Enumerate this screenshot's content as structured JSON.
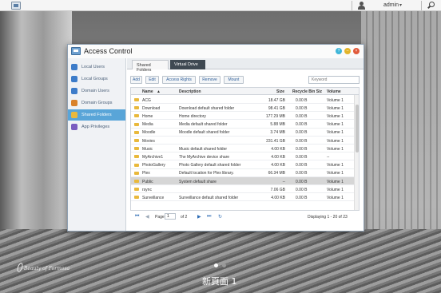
{
  "topbar": {
    "username": "admin",
    "caret": "▾"
  },
  "window": {
    "title": "Access Control",
    "controls": {
      "help": "?",
      "minimize": "–",
      "close": "×"
    }
  },
  "sidebar": {
    "items": [
      {
        "label": "Local Users",
        "icon": "user-icon",
        "color": "#3d7cc9"
      },
      {
        "label": "Local Groups",
        "icon": "group-icon",
        "color": "#3d7cc9"
      },
      {
        "label": "Domain Users",
        "icon": "domain-user-icon",
        "color": "#3d7cc9"
      },
      {
        "label": "Domain Groups",
        "icon": "domain-group-icon",
        "color": "#d9822b"
      },
      {
        "label": "Shared Folders",
        "icon": "folder-icon",
        "color": "#e9b93c",
        "active": true
      },
      {
        "label": "App Privileges",
        "icon": "app-icon",
        "color": "#7a5cc0"
      }
    ]
  },
  "tabs": [
    {
      "label": "Shared Folders"
    },
    {
      "label": "Virtual Drive"
    }
  ],
  "toolbar": {
    "add": "Add",
    "edit": "Edit",
    "access_rights": "Access Rights",
    "remove": "Remove",
    "mount": "Mount",
    "search_placeholder": "Keyword"
  },
  "table": {
    "columns": {
      "name": "Name",
      "sort": "▲",
      "description": "Description",
      "size": "Size",
      "recycle": "Recycle Bin Siz",
      "volume": "Volume"
    },
    "rows": [
      {
        "name": "ACG",
        "description": "",
        "size": "18.47 GB",
        "recycle": "0.00 B",
        "volume": "Volume 1"
      },
      {
        "name": "Download",
        "description": "Download default shared folder",
        "size": "98.41 GB",
        "recycle": "0.00 B",
        "volume": "Volume 1"
      },
      {
        "name": "Home",
        "description": "Home directory",
        "size": "177.29 MB",
        "recycle": "0.00 B",
        "volume": "Volume 1"
      },
      {
        "name": "Media",
        "description": "Media default shared folder",
        "size": "5.88 MB",
        "recycle": "0.00 B",
        "volume": "Volume 1"
      },
      {
        "name": "Moodle",
        "description": "Moodle default shared folder",
        "size": "3.74 MB",
        "recycle": "0.00 B",
        "volume": "Volume 1"
      },
      {
        "name": "Movies",
        "description": "",
        "size": "231.41 GB",
        "recycle": "0.00 B",
        "volume": "Volume 1"
      },
      {
        "name": "Music",
        "description": "Music default shared folder",
        "size": "4.00 KB",
        "recycle": "0.00 B",
        "volume": "Volume 1"
      },
      {
        "name": "MyArchive1",
        "description": "The MyArchive device share",
        "size": "4.00 KB",
        "recycle": "0.00 B",
        "volume": "--"
      },
      {
        "name": "PhotoGallery",
        "description": "Photo Gallery default shared folder",
        "size": "4.00 KB",
        "recycle": "0.00 B",
        "volume": "Volume 1"
      },
      {
        "name": "Plex",
        "description": "Default location for Plex library.",
        "size": "66.34 MB",
        "recycle": "0.00 B",
        "volume": "Volume 1"
      },
      {
        "name": "Public",
        "description": "System default share",
        "size": "--",
        "recycle": "0.00 B",
        "volume": "Volume 1",
        "selected": true
      },
      {
        "name": "rsync",
        "description": "",
        "size": "7.06 GB",
        "recycle": "0.00 B",
        "volume": "Volume 1"
      },
      {
        "name": "Surveillance",
        "description": "Surveillance default shared folder",
        "size": "4.00 KB",
        "recycle": "0.00 B",
        "volume": "Volume 1"
      }
    ]
  },
  "pager": {
    "first": "⏮",
    "prev": "◀",
    "page_label": "Page",
    "page_value": "1",
    "of_label": "of 2",
    "next": "▶",
    "last": "⏭",
    "refresh": "↻",
    "display": "Displaying 1 - 20 of 23"
  },
  "desktop": {
    "caption": "新頁面 1",
    "watermark": "Beauty of Formosa"
  }
}
